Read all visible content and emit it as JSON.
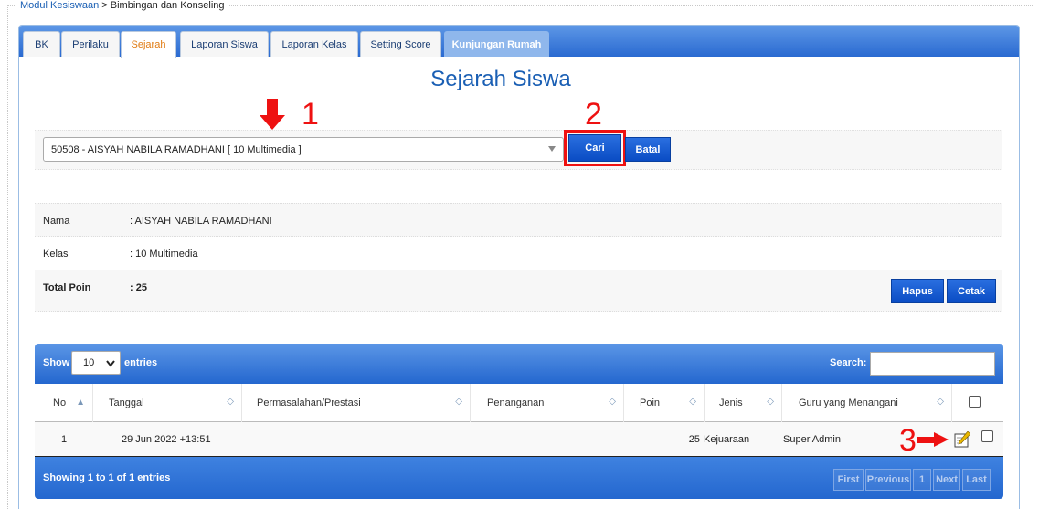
{
  "breadcrumb": {
    "module": "Modul Kesiswaan",
    "separator": ">",
    "current": "Bimbingan dan Konseling"
  },
  "tabs": [
    {
      "label": "BK"
    },
    {
      "label": "Perilaku"
    },
    {
      "label": "Sejarah",
      "active": true
    },
    {
      "label": "Laporan Siswa"
    },
    {
      "label": "Laporan Kelas"
    },
    {
      "label": "Setting Score"
    },
    {
      "label": "Kunjungan Rumah"
    }
  ],
  "page_title": "Sejarah Siswa",
  "annotations": {
    "one": "1",
    "two": "2",
    "three": "3"
  },
  "search": {
    "selected_student": "50508 - AISYAH NABILA RAMADHANI [ 10 Multimedia ]",
    "cari_label": "Cari",
    "batal_label": "Batal"
  },
  "info": {
    "nama_label": "Nama",
    "nama_value": ": AISYAH NABILA RAMADHANI",
    "kelas_label": "Kelas",
    "kelas_value": ": 10 Multimedia",
    "total_label": "Total Poin",
    "total_value": ": 25",
    "hapus_label": "Hapus",
    "cetak_label": "Cetak"
  },
  "table": {
    "show_label": "Show",
    "entries_value": "10",
    "entries_label": "entries",
    "search_label": "Search:",
    "columns": [
      "No",
      "Tanggal",
      "Permasalahan/Prestasi",
      "Penanganan",
      "Poin",
      "Jenis",
      "Guru yang Menangani"
    ],
    "rows": [
      {
        "no": "1",
        "tanggal": "29 Jun 2022 +13:51",
        "permasalahan": "",
        "penanganan": "",
        "poin": "25",
        "jenis": "Kejuaraan",
        "guru": "Super Admin"
      }
    ],
    "info_text": "Showing 1 to 1 of 1 entries",
    "pager": {
      "first": "First",
      "previous": "Previous",
      "page": "1",
      "next": "Next",
      "last": "Last"
    }
  },
  "colors": {
    "accent": "#1a5fb4",
    "button": "#0a4cc4",
    "annotation": "#ee1111",
    "active_tab": "#e07b12"
  }
}
